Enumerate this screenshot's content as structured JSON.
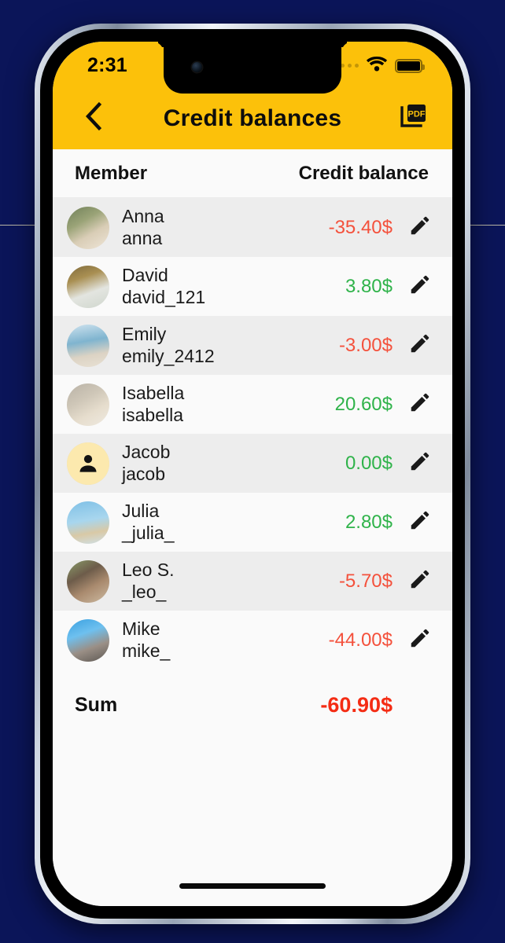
{
  "theme": {
    "brand_yellow": "#FCC10A",
    "negative_color": "#F4513C",
    "positive_color": "#2FB34A",
    "sum_color": "#F42C14",
    "backdrop": "#0b1559"
  },
  "status_bar": {
    "time": "2:31",
    "signal_icon": "signal-dots-icon",
    "wifi_icon": "wifi-icon",
    "battery_icon": "battery-full-icon"
  },
  "nav": {
    "back_icon": "chevron-left-icon",
    "title": "Credit balances",
    "action_icon": "pdf-export-icon",
    "action_label": "PDF"
  },
  "table": {
    "columns": [
      "Member",
      "Credit balance"
    ],
    "edit_icon": "pencil-icon",
    "rows": [
      {
        "name": "Anna",
        "handle": "anna",
        "amount": "-35.40$",
        "sign": "neg",
        "avatar": "photo"
      },
      {
        "name": "David",
        "handle": "david_121",
        "amount": "3.80$",
        "sign": "pos",
        "avatar": "photo"
      },
      {
        "name": "Emily",
        "handle": "emily_2412",
        "amount": "-3.00$",
        "sign": "neg",
        "avatar": "photo"
      },
      {
        "name": "Isabella",
        "handle": "isabella",
        "amount": "20.60$",
        "sign": "pos",
        "avatar": "photo"
      },
      {
        "name": "Jacob",
        "handle": "jacob",
        "amount": "0.00$",
        "sign": "pos",
        "avatar": "placeholder"
      },
      {
        "name": "Julia",
        "handle": "_julia_",
        "amount": "2.80$",
        "sign": "pos",
        "avatar": "photo"
      },
      {
        "name": "Leo S.",
        "handle": "_leo_",
        "amount": "-5.70$",
        "sign": "neg",
        "avatar": "photo"
      },
      {
        "name": "Mike",
        "handle": "mike_",
        "amount": "-44.00$",
        "sign": "neg",
        "avatar": "photo"
      }
    ]
  },
  "summary": {
    "label": "Sum",
    "value": "-60.90$"
  },
  "home_indicator": "home-indicator"
}
